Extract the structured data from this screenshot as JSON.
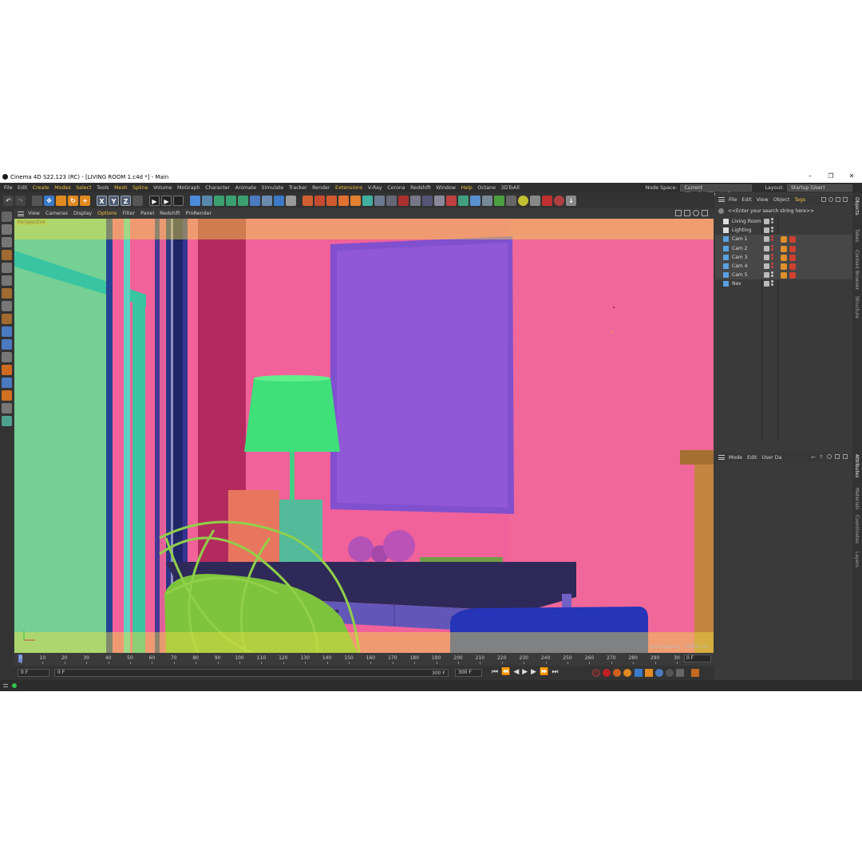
{
  "window": {
    "title": "Cinema 4D S22.123 (RC) - [LIVING ROOM 1.c4d *] - Main",
    "controls": [
      "–",
      "❐",
      "✕"
    ]
  },
  "menubar": {
    "items": [
      "File",
      "Edit",
      "Create",
      "Modes",
      "Select",
      "Tools",
      "Mesh",
      "Spline",
      "Volume",
      "MoGraph",
      "Character",
      "Animate",
      "Simulate",
      "Tracker",
      "Render",
      "Extensions",
      "V-Ray",
      "Corona",
      "Redshift",
      "Window",
      "Help",
      "Octane",
      "3DToAll"
    ],
    "node_space_label": "Node Space:",
    "node_space_value": "Current (Standard/Physical)",
    "layout_label": "Layout:",
    "layout_value": "Startup (User)"
  },
  "toolbar": {
    "axis_x": "X",
    "axis_y": "Y",
    "axis_z": "Z"
  },
  "viewport": {
    "menu": [
      "View",
      "Cameras",
      "Display",
      "Options",
      "Filter",
      "Panel",
      "Redshift",
      "ProRender"
    ],
    "label": "Perspective",
    "grid_spacing": "Grid Spacing : 10000 cm"
  },
  "timeline": {
    "ticks": [
      "0",
      "10",
      "20",
      "30",
      "40",
      "50",
      "60",
      "70",
      "80",
      "90",
      "100",
      "110",
      "120",
      "130",
      "140",
      "150",
      "160",
      "170",
      "180",
      "190",
      "200",
      "210",
      "220",
      "230",
      "240",
      "250",
      "260",
      "270",
      "280",
      "290",
      "30"
    ],
    "current_frame": "0 F"
  },
  "playback": {
    "start": "0 F",
    "preview_start": "0 F",
    "preview_end": "300 F",
    "end": "300 F"
  },
  "objects_panel": {
    "menu": [
      "File",
      "Edit",
      "View",
      "Object",
      "Tags"
    ],
    "search_placeholder": "<<Enter your search string here>>",
    "objects": [
      {
        "name": "Living Room",
        "type": "null"
      },
      {
        "name": "Lighting",
        "type": "null"
      },
      {
        "name": "Cam 1",
        "type": "camera"
      },
      {
        "name": "Cam 2",
        "type": "camera"
      },
      {
        "name": "Cam 3",
        "type": "camera"
      },
      {
        "name": "Cam 4",
        "type": "camera"
      },
      {
        "name": "Cam 5",
        "type": "camera"
      },
      {
        "name": "Nav",
        "type": "camera"
      }
    ]
  },
  "attributes_panel": {
    "menu": [
      "Mode",
      "Edit",
      "User Da"
    ]
  },
  "side_tabs": {
    "top": [
      "Objects",
      "Takes",
      "Content Browser",
      "Structure"
    ],
    "bottom": [
      "Attributes",
      "Materials",
      "Coordinates",
      "Layers"
    ]
  },
  "colors": {
    "wall": "#f25aa0",
    "frame": "#8b4fe0",
    "lampshade": "#35e07e",
    "desk": "#5a4fc0",
    "chair": "#78c23c",
    "window": "#6fcf9a",
    "overlay": "#e6e64a"
  }
}
